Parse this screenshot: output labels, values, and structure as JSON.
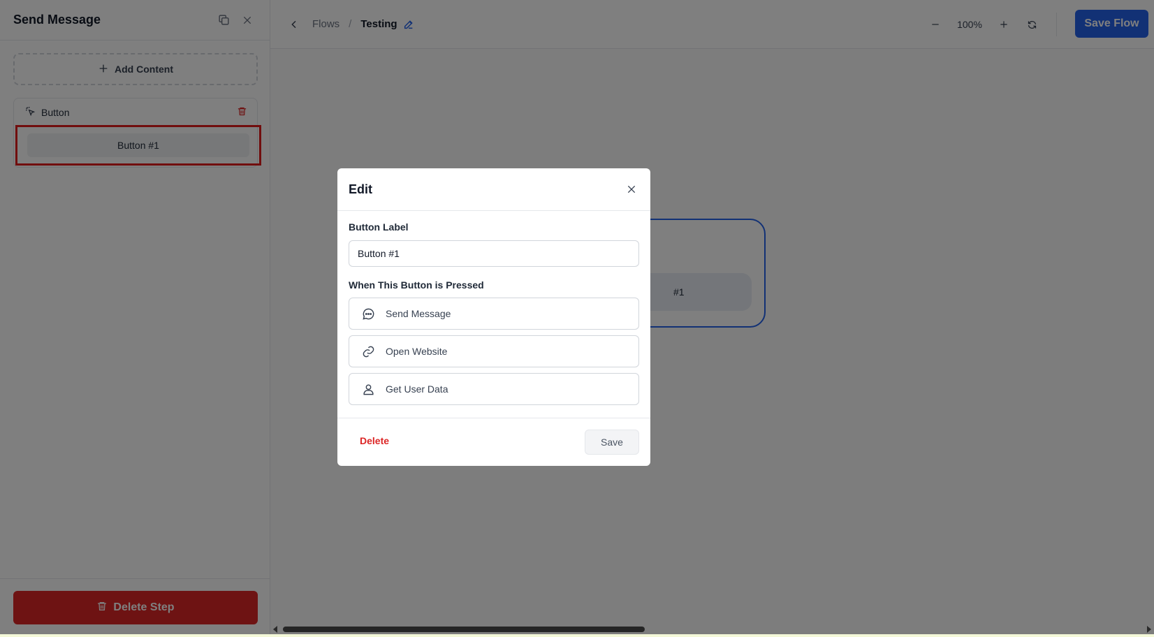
{
  "sidebar": {
    "title": "Send Message",
    "add_content_label": "Add Content",
    "card": {
      "title": "Button",
      "button_label": "Button #1"
    },
    "delete_step_label": "Delete Step"
  },
  "topbar": {
    "breadcrumb_parent": "Flows",
    "breadcrumb_separator": "/",
    "breadcrumb_current": "Testing",
    "zoom_value": "100%",
    "save_flow_label": "Save Flow"
  },
  "node": {
    "button_text": "#1"
  },
  "modal": {
    "title": "Edit",
    "button_label_heading": "Button Label",
    "button_label_value": "Button #1",
    "when_pressed_heading": "When This Button is Pressed",
    "options": [
      {
        "label": "Send Message",
        "icon": "chat-bubble-icon"
      },
      {
        "label": "Open Website",
        "icon": "link-icon"
      },
      {
        "label": "Get User Data",
        "icon": "user-icon"
      }
    ],
    "delete_label": "Delete",
    "save_label": "Save"
  },
  "colors": {
    "accent": "#2563eb",
    "danger": "#dc2626",
    "highlight": "#e21d1d"
  }
}
